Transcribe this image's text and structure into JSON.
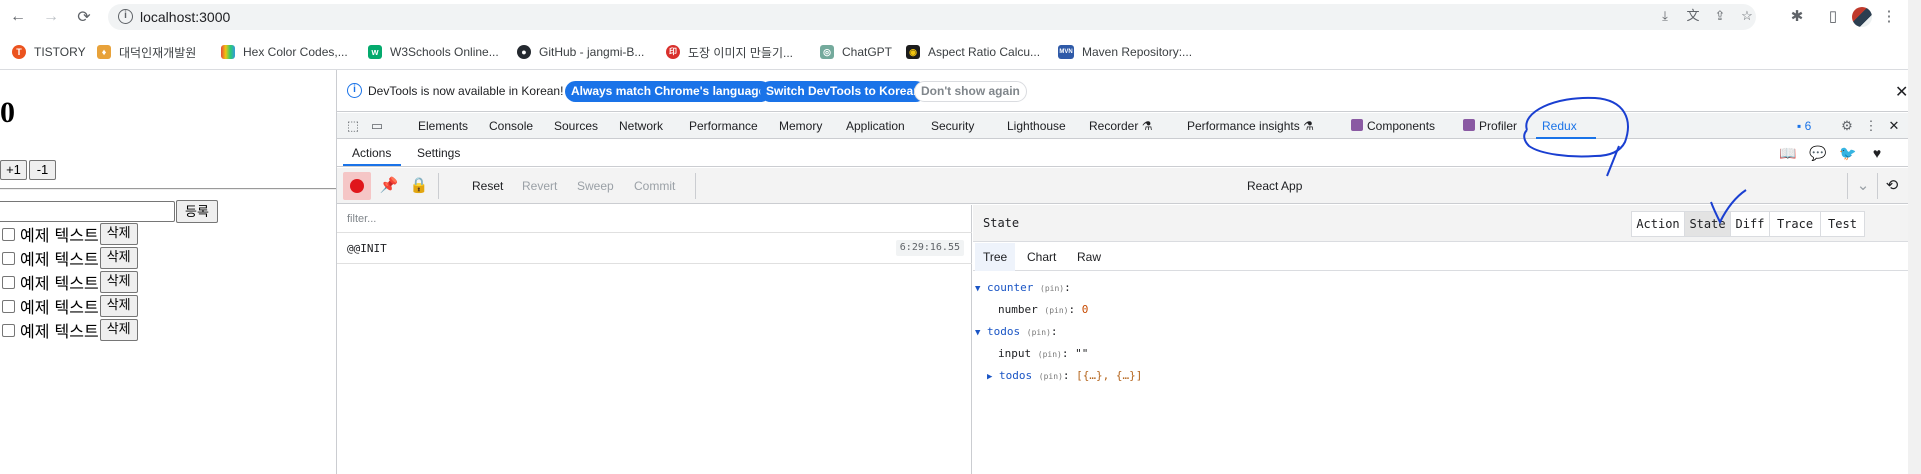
{
  "browser": {
    "url": "localhost:3000",
    "bookmarks": [
      {
        "label": "TISTORY",
        "color": "#eb531f",
        "glyph": "T"
      },
      {
        "label": "대덕인재개발원",
        "color": "#e8a23a",
        "glyph": "♦"
      },
      {
        "label": "Hex Color Codes,...",
        "color": "#3a6ee8",
        "glyph": "▮"
      },
      {
        "label": "W3Schools Online...",
        "color": "#04aa6d",
        "glyph": "w"
      },
      {
        "label": "GitHub - jangmi-B...",
        "color": "#24292f",
        "glyph": "●"
      },
      {
        "label": "도장 이미지 만들기...",
        "color": "#d9302c",
        "glyph": "印"
      },
      {
        "label": "ChatGPT",
        "color": "#74aa9c",
        "glyph": "◎"
      },
      {
        "label": "Aspect Ratio Calcu...",
        "color": "#1c1c1c",
        "glyph": "◉"
      },
      {
        "label": "Maven Repository:...",
        "color": "#2f5aa8",
        "glyph": "MVN"
      }
    ]
  },
  "app": {
    "counter": "0",
    "increment_label": "+1",
    "decrement_label": "-1",
    "input_value": "",
    "add_label": "등록",
    "todos": [
      {
        "text": "예제 텍스트",
        "checked": false,
        "delete_label": "삭제"
      },
      {
        "text": "예제 텍스트",
        "checked": false,
        "delete_label": "삭제"
      },
      {
        "text": "예제 텍스트",
        "checked": false,
        "delete_label": "삭제"
      },
      {
        "text": "예제 텍스트",
        "checked": false,
        "delete_label": "삭제"
      },
      {
        "text": "예제 텍스트",
        "checked": false,
        "delete_label": "삭제"
      }
    ]
  },
  "devtools": {
    "infobar": {
      "message": "DevTools is now available in Korean!",
      "match_language": "Always match Chrome's language",
      "switch_korean": "Switch DevTools to Korean",
      "dont_show": "Don't show again"
    },
    "tabs": [
      "Elements",
      "Console",
      "Sources",
      "Network",
      "Performance",
      "Memory",
      "Application",
      "Security",
      "Lighthouse",
      "Recorder",
      "Performance insights",
      "Components",
      "Profiler",
      "Redux"
    ],
    "active_tab": "Redux",
    "issues_count": "6",
    "subtabs": [
      "Actions",
      "Settings"
    ],
    "toolbar": {
      "reset": "Reset",
      "revert": "Revert",
      "sweep": "Sweep",
      "commit": "Commit",
      "instance": "React App"
    },
    "actions": {
      "filter_placeholder": "filter...",
      "items": [
        {
          "name": "@@INIT",
          "time": "6:29:16.55"
        }
      ]
    },
    "state": {
      "title": "State",
      "mode_buttons": [
        "Action",
        "State",
        "Diff",
        "Trace",
        "Test"
      ],
      "active_mode": "State",
      "view_tabs": [
        "Tree",
        "Chart",
        "Raw"
      ],
      "active_view": "Tree",
      "tree": {
        "counter_key": "counter",
        "number_key": "number",
        "number_value": "0",
        "todos_key": "todos",
        "input_key": "input",
        "input_value": "\"\"",
        "todos_list_key": "todos",
        "todos_list_value": "[{…}, {…}]",
        "pin": "(pin)"
      }
    }
  },
  "colors": {
    "accent": "#1a73e8",
    "record": "#e0161b",
    "annotation": "#1a3fd1"
  }
}
